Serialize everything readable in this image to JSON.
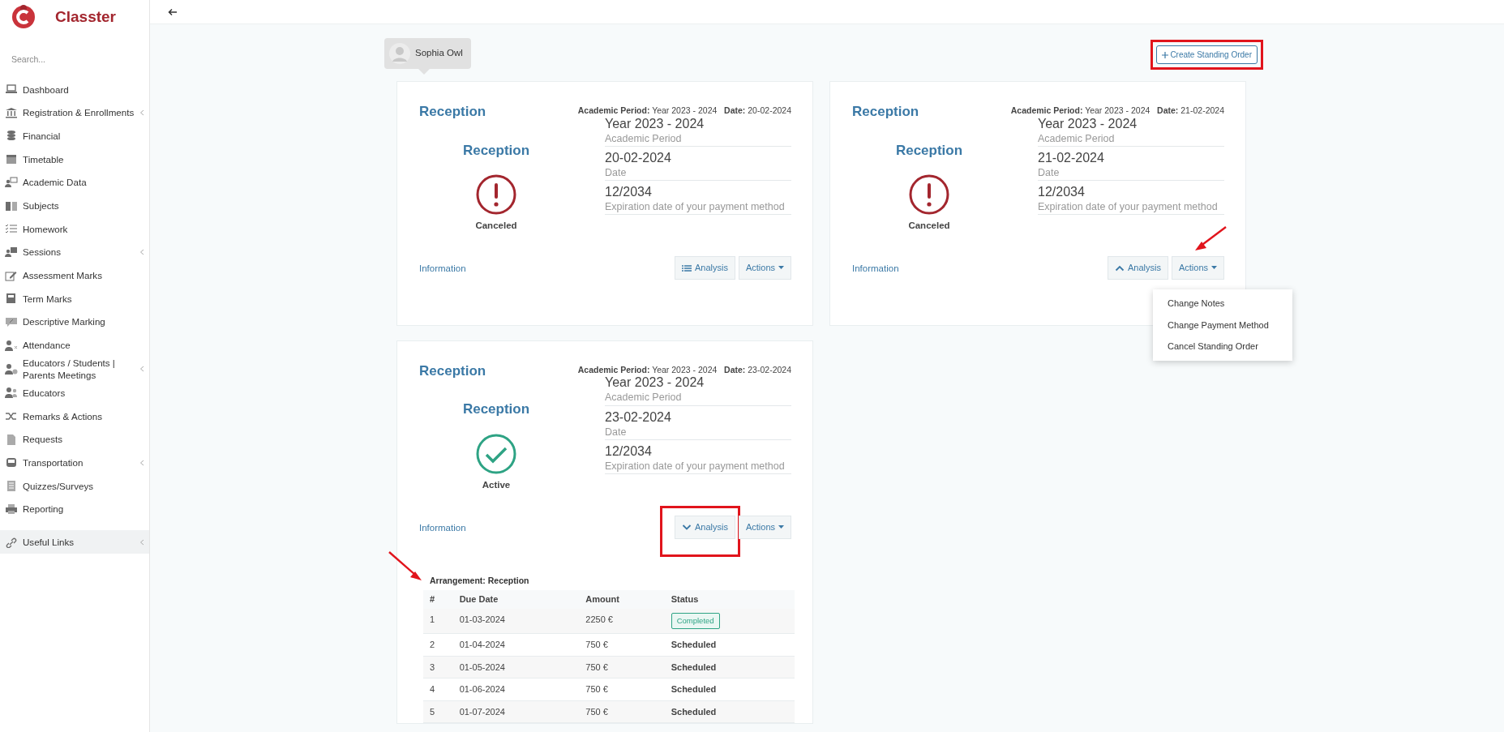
{
  "brand": "Classter",
  "search": {
    "placeholder": "Search..."
  },
  "sidebar": {
    "items": [
      {
        "label": "Dashboard",
        "has_submenu": false
      },
      {
        "label": "Registration & Enrollments",
        "has_submenu": true
      },
      {
        "label": "Financial",
        "has_submenu": false
      },
      {
        "label": "Timetable",
        "has_submenu": false
      },
      {
        "label": "Academic Data",
        "has_submenu": false
      },
      {
        "label": "Subjects",
        "has_submenu": false
      },
      {
        "label": "Homework",
        "has_submenu": false
      },
      {
        "label": "Sessions",
        "has_submenu": true
      },
      {
        "label": "Assessment Marks",
        "has_submenu": false
      },
      {
        "label": "Term Marks",
        "has_submenu": false
      },
      {
        "label": "Descriptive Marking",
        "has_submenu": false
      },
      {
        "label": "Attendance",
        "has_submenu": false
      },
      {
        "label": "Educators / Students | Parents Meetings",
        "has_submenu": true
      },
      {
        "label": "Educators",
        "has_submenu": false
      },
      {
        "label": "Remarks & Actions",
        "has_submenu": false
      },
      {
        "label": "Requests",
        "has_submenu": false
      },
      {
        "label": "Transportation",
        "has_submenu": true
      },
      {
        "label": "Quizzes/Surveys",
        "has_submenu": false
      },
      {
        "label": "Reporting",
        "has_submenu": false
      }
    ],
    "footer_items": [
      {
        "label": "Useful Links",
        "has_submenu": true
      }
    ]
  },
  "student": {
    "name": "Sophia Owl"
  },
  "create_button": {
    "label": "Create Standing Order",
    "highlighted": true
  },
  "orders": [
    {
      "title": "Reception",
      "period_label": "Academic Period:",
      "period": "Year 2023 - 2024",
      "date_label": "Date:",
      "date": "20-02-2024",
      "plan": "Reception",
      "status": {
        "kind": "canceled",
        "label": "Canceled"
      },
      "fields": [
        {
          "value": "Year 2023 - 2024",
          "label": "Academic Period"
        },
        {
          "value": "20-02-2024",
          "label": "Date"
        },
        {
          "value": "12/2034",
          "label": "Expiration date of your payment method"
        }
      ],
      "info_link": "Information",
      "analysis": {
        "label": "Analysis",
        "kind": "list",
        "highlighted": false
      },
      "actions": {
        "label": "Actions",
        "pointed": false,
        "expanded": false
      }
    },
    {
      "title": "Reception",
      "period_label": "Academic Period:",
      "period": "Year 2023 - 2024",
      "date_label": "Date:",
      "date": "21-02-2024",
      "plan": "Reception",
      "status": {
        "kind": "canceled",
        "label": "Canceled"
      },
      "fields": [
        {
          "value": "Year 2023 - 2024",
          "label": "Academic Period"
        },
        {
          "value": "21-02-2024",
          "label": "Date"
        },
        {
          "value": "12/2034",
          "label": "Expiration date of your payment method"
        }
      ],
      "info_link": "Information",
      "analysis": {
        "label": "Analysis",
        "kind": "collapse",
        "highlighted": false
      },
      "actions": {
        "label": "Actions",
        "pointed": true,
        "expanded": true,
        "menu": [
          "Change Notes",
          "Change Payment Method",
          "Cancel Standing Order"
        ]
      }
    },
    {
      "title": "Reception",
      "period_label": "Academic Period:",
      "period": "Year 2023 - 2024",
      "date_label": "Date:",
      "date": "23-02-2024",
      "plan": "Reception",
      "status": {
        "kind": "active",
        "label": "Active"
      },
      "fields": [
        {
          "value": "Year 2023 - 2024",
          "label": "Academic Period"
        },
        {
          "value": "23-02-2024",
          "label": "Date"
        },
        {
          "value": "12/2034",
          "label": "Expiration date of your payment method"
        }
      ],
      "info_link": "Information",
      "analysis": {
        "label": "Analysis",
        "kind": "expand",
        "highlighted": true
      },
      "actions": {
        "label": "Actions",
        "pointed": false,
        "expanded": false
      },
      "schedule": {
        "title": "Arrangement: Reception",
        "pointed": true,
        "columns": [
          "#",
          "Due Date",
          "Amount",
          "Status"
        ],
        "rows": [
          {
            "number": "1",
            "due_date": "01-03-2024",
            "amount": "2250 €",
            "status": "Completed",
            "kind": "badge"
          },
          {
            "number": "2",
            "due_date": "01-04-2024",
            "amount": "750 €",
            "status": "Scheduled",
            "kind": "text"
          },
          {
            "number": "3",
            "due_date": "01-05-2024",
            "amount": "750 €",
            "status": "Scheduled",
            "kind": "text"
          },
          {
            "number": "4",
            "due_date": "01-06-2024",
            "amount": "750 €",
            "status": "Scheduled",
            "kind": "text"
          },
          {
            "number": "5",
            "due_date": "01-07-2024",
            "amount": "750 €",
            "status": "Scheduled",
            "kind": "text"
          }
        ]
      }
    }
  ]
}
